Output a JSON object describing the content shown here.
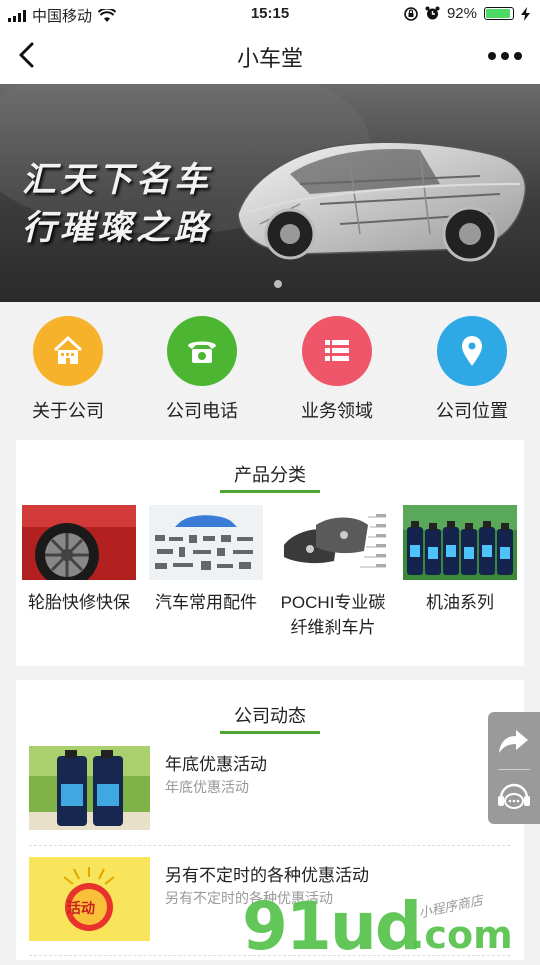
{
  "status_bar": {
    "carrier": "中国移动",
    "time": "15:15",
    "battery": "92%",
    "battery_level": 0.92
  },
  "nav": {
    "title": "小车堂"
  },
  "banner": {
    "slogan_line1": "汇天下名车",
    "slogan_line2": "行璀璨之路"
  },
  "quick_links": [
    {
      "label": "关于公司",
      "icon": "house-icon",
      "color": "#f6b22a"
    },
    {
      "label": "公司电话",
      "icon": "telephone-icon",
      "color": "#4cb632"
    },
    {
      "label": "业务领域",
      "icon": "list-icon",
      "color": "#f0566a"
    },
    {
      "label": "公司位置",
      "icon": "location-pin-icon",
      "color": "#2fa8e6"
    }
  ],
  "products": {
    "title": "产品分类",
    "items": [
      {
        "label": "轮胎快修快保"
      },
      {
        "label": "汽车常用配件"
      },
      {
        "label_line1": "POCHI专业碳",
        "label_line2": "纤维刹车片"
      },
      {
        "label": "机油系列"
      }
    ]
  },
  "news": {
    "title": "公司动态",
    "items": [
      {
        "title": "年底优惠活动",
        "subtitle": "年底优惠活动"
      },
      {
        "title": "另有不定时的各种优惠活动",
        "subtitle": "另有不定时的各种优惠活动",
        "thumb_text": "活动"
      }
    ]
  },
  "watermark": {
    "main": "91ud",
    "suffix": ".com",
    "small": "小程序商店"
  },
  "colors": {
    "accent_green": "#4aa832",
    "float_bg": "#9a9a9a"
  }
}
